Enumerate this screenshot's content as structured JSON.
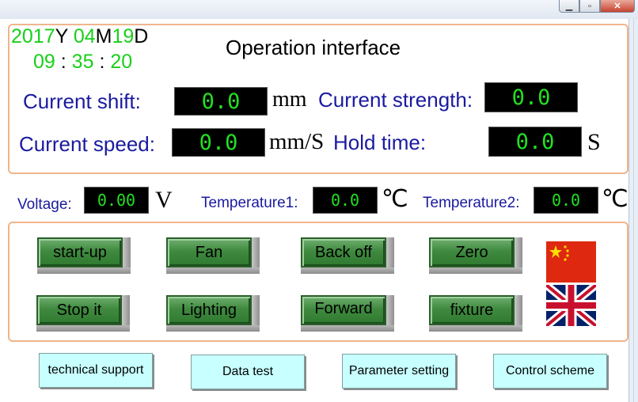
{
  "datetime": {
    "year": "2017",
    "year_suffix": "Y",
    "month": "04",
    "month_suffix": "M",
    "day": "19",
    "day_suffix": "D",
    "hour": "09",
    "minute": "35",
    "second": "20",
    "sep": ":"
  },
  "title": "Operation interface",
  "readouts": {
    "shift": {
      "label": "Current shift:",
      "value": "0.0",
      "unit": "mm"
    },
    "strength": {
      "label": "Current strength:",
      "value": "0.0"
    },
    "speed": {
      "label": "Current speed:",
      "value": "0.0",
      "unit": "mm/S"
    },
    "hold": {
      "label": "Hold time:",
      "value": "0.0",
      "unit": "S"
    }
  },
  "sensors": {
    "voltage": {
      "label": "Voltage:",
      "value": "0.00",
      "unit": "V"
    },
    "temp1": {
      "label": "Temperature1:",
      "value": "0.0",
      "unit": "℃"
    },
    "temp2": {
      "label": "Temperature2:",
      "value": "0.0",
      "unit": "℃"
    }
  },
  "controls": {
    "startup": "start-up",
    "fan": "Fan",
    "back_off": "Back off",
    "zero": "Zero",
    "stop": "Stop it",
    "lighting": "Lighting",
    "forward": "Forward",
    "fixture": "fixture"
  },
  "languages": {
    "cn_flag_icon": "china-flag-icon",
    "uk_flag_icon": "uk-flag-icon"
  },
  "bottom_nav": {
    "tech_support": "technical support",
    "data_test": "Data test",
    "param_setting": "Parameter setting",
    "control_scheme": "Control scheme"
  },
  "colors": {
    "panel_border": "#f0b48c",
    "label_blue": "#1a1aa0",
    "display_green": "#22e022",
    "button_green": "#3f8a3f",
    "nav_cyan": "#c8ffff"
  }
}
